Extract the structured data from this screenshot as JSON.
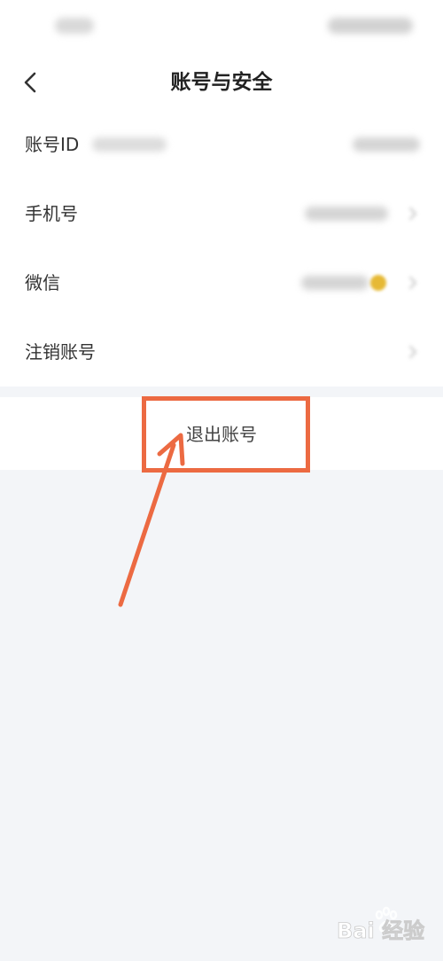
{
  "header": {
    "title": "账号与安全"
  },
  "settings": {
    "items": [
      {
        "label": "账号ID"
      },
      {
        "label": "手机号"
      },
      {
        "label": "微信"
      },
      {
        "label": "注销账号"
      }
    ]
  },
  "logout": {
    "label": "退出账号"
  },
  "colors": {
    "annotation": "#ec6a42",
    "page_background": "#f3f5f8",
    "card_background": "#ffffff"
  },
  "icons": {
    "back": "chevron-left-icon",
    "row_arrow": "chevron-right-icon"
  },
  "watermark": {
    "text": "Bai 经验"
  }
}
